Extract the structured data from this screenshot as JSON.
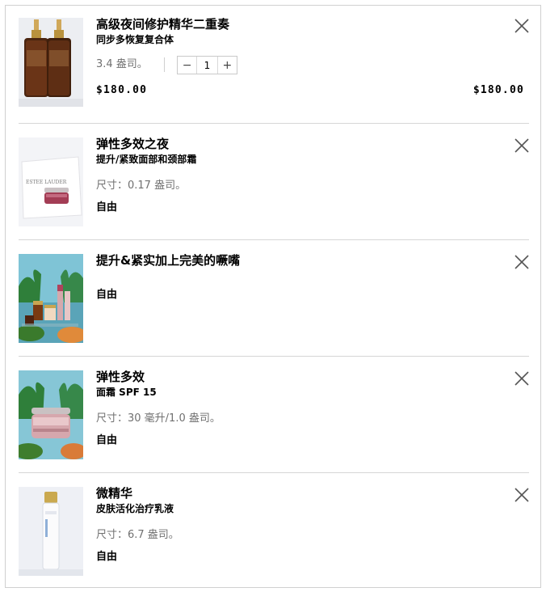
{
  "cart": {
    "items": [
      {
        "title": "高级夜间修护精华二重奏",
        "subtitle": "同步多恢复复合体",
        "size": "3.4 盎司。",
        "quantity": "1",
        "unit_price": "$180.00",
        "total_price": "$180.00",
        "image_icon": "serum-duo-bottles-icon"
      },
      {
        "title": "弹性多效之夜",
        "subtitle": "提升/紧致面部和颈部霜",
        "size": "尺寸：0.17 盎司。",
        "status": "自由",
        "image_brand": "ESTEE LAUDER",
        "image_icon": "cream-jar-box-icon"
      },
      {
        "title": "提升&紧实加上完美的噘嘴",
        "status": "自由",
        "image_icon": "gift-set-illustration-icon"
      },
      {
        "title": "弹性多效",
        "subtitle": "面霜 SPF 15",
        "size": "尺寸：30 毫升/1.0 盎司。",
        "status": "自由",
        "image_icon": "cream-jar-illustration-icon"
      },
      {
        "title": "微精华",
        "subtitle": "皮肤活化治疗乳液",
        "size": "尺寸：6.7 盎司。",
        "status": "自由",
        "image_icon": "essence-bottle-icon"
      }
    ],
    "remove_icon": "close-icon",
    "decrement_label": "−",
    "increment_label": "+"
  }
}
